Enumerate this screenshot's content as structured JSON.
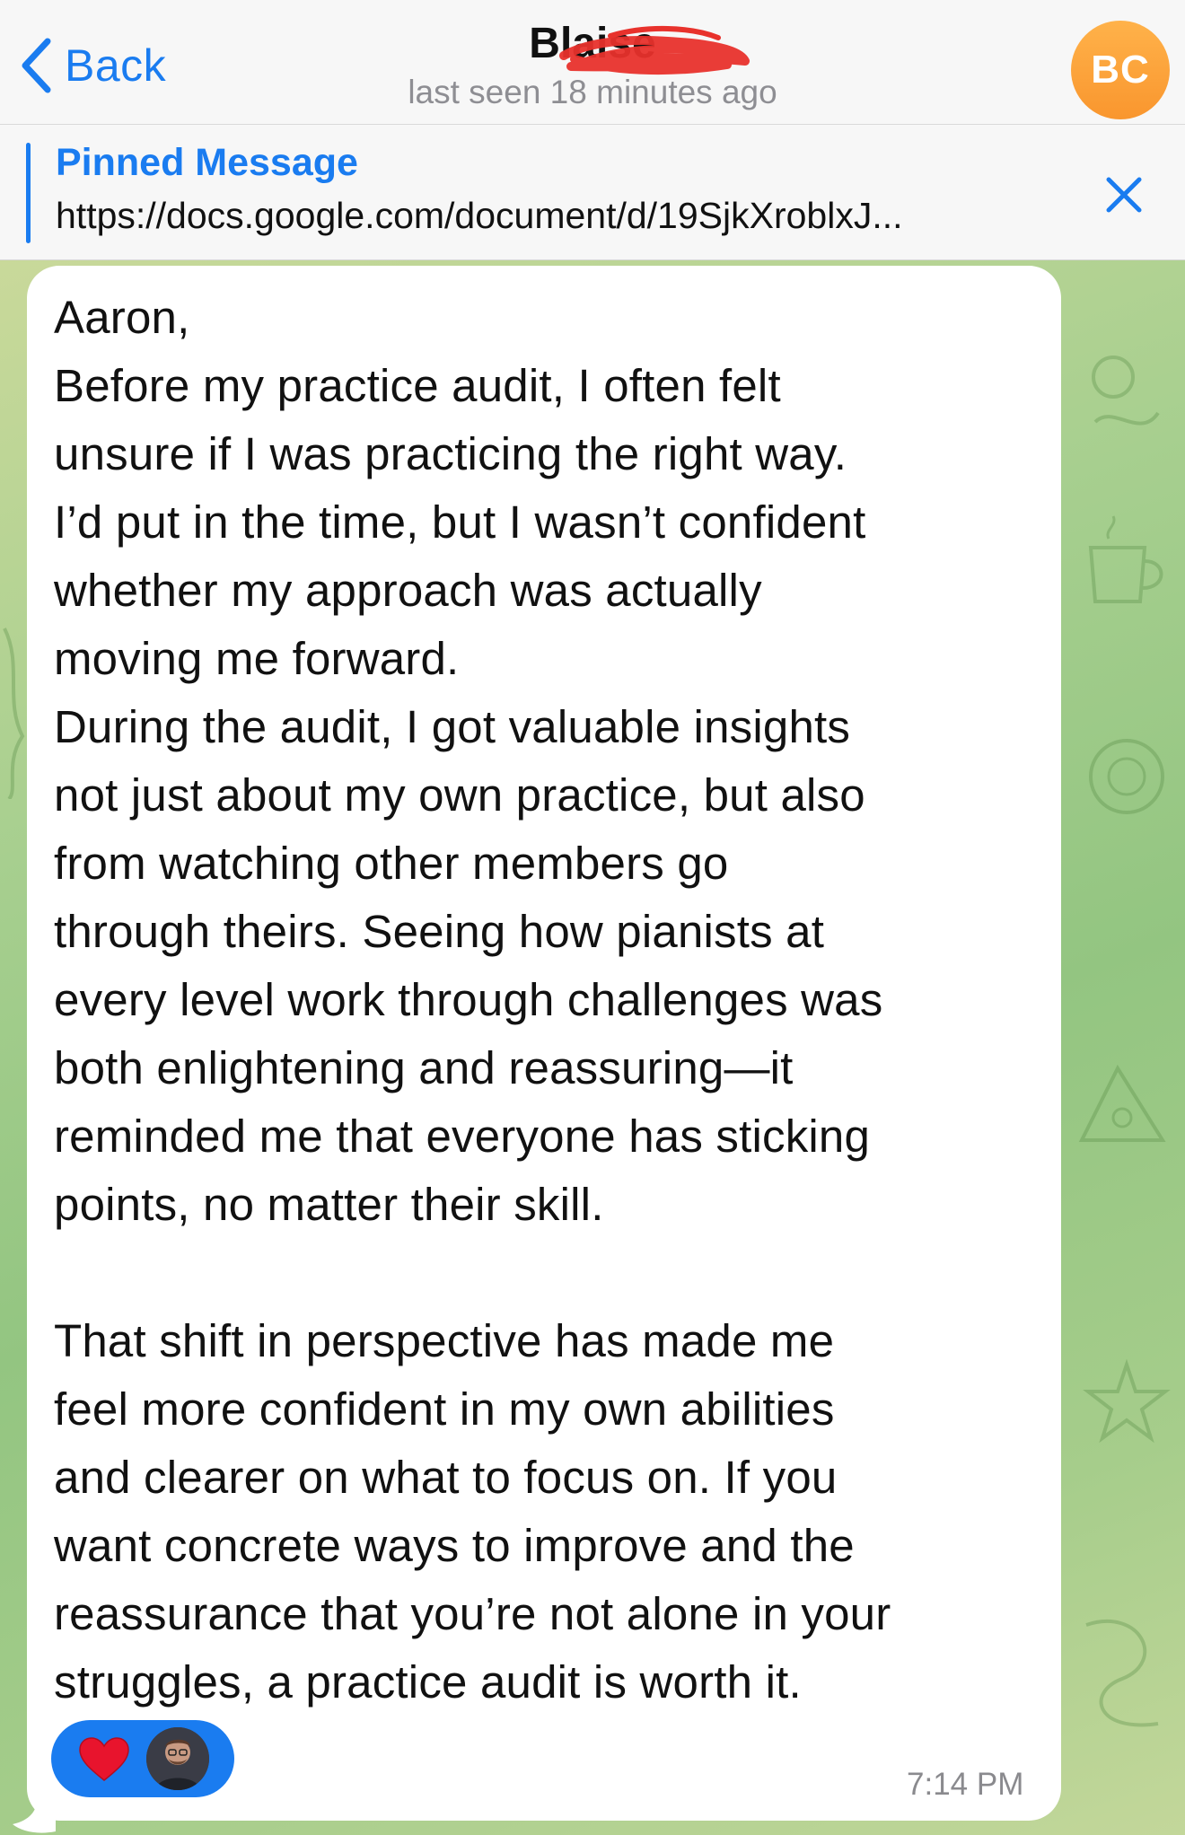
{
  "header": {
    "back_label": "Back",
    "contact_name": "Blaise",
    "status": "last seen 18 minutes ago",
    "avatar_initials": "BC",
    "avatar_color": "#f9962e"
  },
  "pinned": {
    "title": "Pinned Message",
    "text": "https://docs.google.com/document/d/19SjkXroblxJ..."
  },
  "message": {
    "text": "Aaron,\nBefore my practice audit, I often felt\nunsure if I was practicing the right way.\nI’d put in the time, but I wasn’t confident\nwhether my approach was actually\nmoving me forward.\nDuring the audit, I got valuable insights\nnot just about my own practice, but also\nfrom watching other members go\nthrough theirs. Seeing how pianists at\nevery level work through challenges was\nboth enlightening and reassuring—it\nreminded me that everyone has sticking\npoints, no matter their skill.\n\nThat shift in perspective has made me\nfeel more confident in my own abilities\nand clearer on what to focus on. If you\nwant concrete ways to improve and the\nreassurance that you’re not alone in your\nstruggles, a practice audit is worth it.",
    "time": "7:14 PM",
    "reaction": {
      "emoji": "heart-icon",
      "reactor": "reactor-avatar"
    }
  },
  "colors": {
    "accent": "#1a7cf0",
    "heart": "#e8142d",
    "bubble": "#ffffff",
    "wallpaper": "#9fcb87"
  }
}
